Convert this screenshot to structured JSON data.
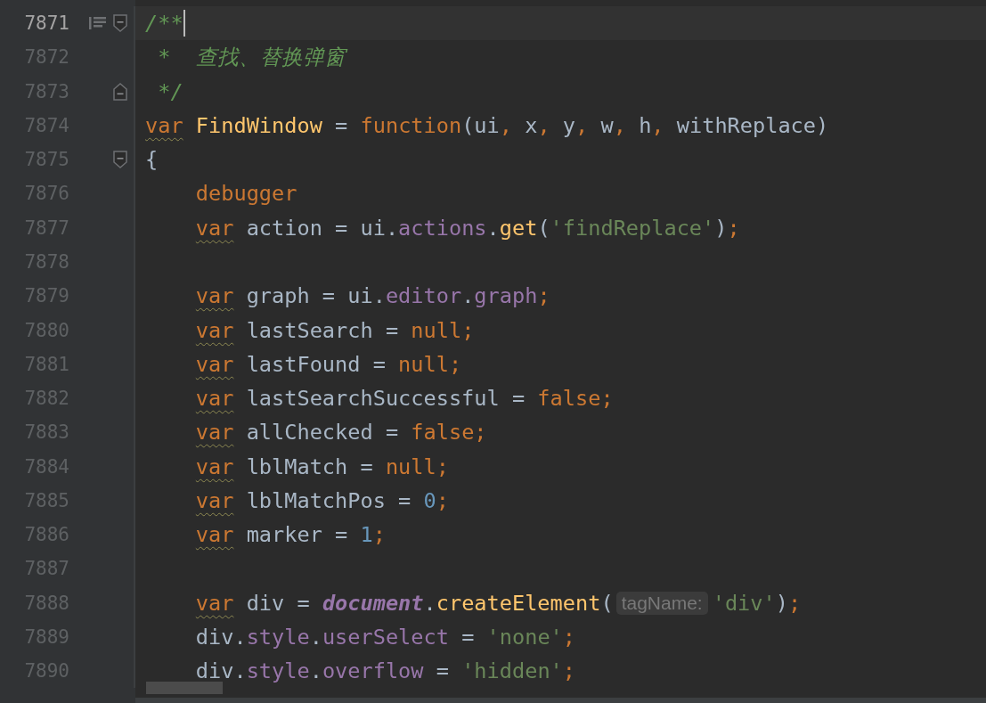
{
  "editor": {
    "lines": [
      {
        "number": "7871",
        "current": true,
        "gutter_icon": true,
        "fold_start": true,
        "fold_end": false,
        "kind": "code",
        "caret": true,
        "tokens": [
          {
            "kind": "comment",
            "text": "/**"
          }
        ]
      },
      {
        "number": "7872",
        "current": false,
        "gutter_icon": false,
        "fold_start": false,
        "fold_end": false,
        "kind": "doc-continuation",
        "caret": false,
        "tokens": [
          {
            "kind": "comment",
            "text": "*  查找、替换弹窗"
          }
        ]
      },
      {
        "number": "7873",
        "current": false,
        "gutter_icon": false,
        "fold_start": false,
        "fold_end": true,
        "kind": "doc-continuation",
        "caret": false,
        "tokens": [
          {
            "kind": "comment",
            "text": "*/"
          }
        ]
      },
      {
        "number": "7874",
        "current": false,
        "gutter_icon": false,
        "fold_start": false,
        "fold_end": false,
        "kind": "code",
        "caret": false,
        "tokens": [
          {
            "kind": "keyword",
            "text": "var",
            "warn": true
          },
          {
            "kind": "function",
            "text": " FindWindow"
          },
          {
            "kind": "plain",
            "text": " = "
          },
          {
            "kind": "keyword",
            "text": "function"
          },
          {
            "kind": "plain",
            "text": "(ui"
          },
          {
            "kind": "punct",
            "text": ", "
          },
          {
            "kind": "plain",
            "text": "x"
          },
          {
            "kind": "punct",
            "text": ", "
          },
          {
            "kind": "plain",
            "text": "y"
          },
          {
            "kind": "punct",
            "text": ", "
          },
          {
            "kind": "plain",
            "text": "w"
          },
          {
            "kind": "punct",
            "text": ", "
          },
          {
            "kind": "plain",
            "text": "h"
          },
          {
            "kind": "punct",
            "text": ", "
          },
          {
            "kind": "plain",
            "text": "withReplace)"
          }
        ]
      },
      {
        "number": "7875",
        "current": false,
        "gutter_icon": false,
        "fold_start": true,
        "fold_end": false,
        "kind": "code",
        "caret": false,
        "tokens": [
          {
            "kind": "plain",
            "text": "{"
          }
        ],
        "children": [
          {
            "number": "7876",
            "current": false,
            "gutter_icon": false,
            "fold_start": false,
            "fold_end": false,
            "kind": "code",
            "caret": false,
            "tokens": [
              {
                "kind": "keyword",
                "text": "debugger"
              }
            ]
          },
          {
            "number": "7877",
            "current": false,
            "gutter_icon": false,
            "fold_start": false,
            "fold_end": false,
            "kind": "code",
            "caret": false,
            "tokens": [
              {
                "kind": "keyword",
                "text": "var",
                "warn": true
              },
              {
                "kind": "plain",
                "text": " action = ui."
              },
              {
                "kind": "property",
                "text": "actions"
              },
              {
                "kind": "plain",
                "text": "."
              },
              {
                "kind": "function",
                "text": "get"
              },
              {
                "kind": "plain",
                "text": "("
              },
              {
                "kind": "string",
                "text": "'findReplace'"
              },
              {
                "kind": "plain",
                "text": ")"
              },
              {
                "kind": "punct",
                "text": ";"
              }
            ]
          },
          {
            "number": "7878",
            "current": false,
            "gutter_icon": false,
            "fold_start": false,
            "fold_end": false,
            "kind": "code",
            "caret": false
          },
          {
            "number": "7879",
            "current": false,
            "gutter_icon": false,
            "fold_start": false,
            "fold_end": false,
            "kind": "code",
            "caret": false,
            "tokens": [
              {
                "kind": "keyword",
                "text": "var",
                "warn": true
              },
              {
                "kind": "plain",
                "text": " graph = ui."
              },
              {
                "kind": "property",
                "text": "editor"
              },
              {
                "kind": "plain",
                "text": "."
              },
              {
                "kind": "property",
                "text": "graph"
              },
              {
                "kind": "punct",
                "text": ";"
              }
            ]
          },
          {
            "number": "7880",
            "current": false,
            "gutter_icon": false,
            "fold_start": false,
            "fold_end": false,
            "kind": "code",
            "caret": false,
            "tokens": [
              {
                "kind": "keyword",
                "text": "var",
                "warn": true
              },
              {
                "kind": "plain",
                "text": " lastSearch = "
              },
              {
                "kind": "keyword",
                "text": "null;"
              }
            ]
          },
          {
            "number": "7881",
            "current": false,
            "gutter_icon": false,
            "fold_start": false,
            "fold_end": false,
            "kind": "code",
            "caret": false,
            "tokens": [
              {
                "kind": "keyword",
                "text": "var",
                "warn": true
              },
              {
                "kind": "plain",
                "text": " lastFound = "
              },
              {
                "kind": "keyword",
                "text": "null;"
              }
            ]
          },
          {
            "number": "7882",
            "current": false,
            "gutter_icon": false,
            "fold_start": false,
            "fold_end": false,
            "kind": "code",
            "caret": false,
            "tokens": [
              {
                "kind": "keyword",
                "text": "var",
                "warn": true
              },
              {
                "kind": "plain",
                "text": " lastSearchSuccessful = "
              },
              {
                "kind": "keyword",
                "text": "false;"
              }
            ]
          },
          {
            "number": "7883",
            "current": false,
            "gutter_icon": false,
            "fold_start": false,
            "fold_end": false,
            "kind": "code",
            "caret": false,
            "tokens": [
              {
                "kind": "keyword",
                "text": "var",
                "warn": true
              },
              {
                "kind": "plain",
                "text": " allChecked = "
              },
              {
                "kind": "keyword",
                "text": "false;"
              }
            ]
          },
          {
            "number": "7884",
            "current": false,
            "gutter_icon": false,
            "fold_start": false,
            "fold_end": false,
            "kind": "code",
            "caret": false,
            "tokens": [
              {
                "kind": "keyword",
                "text": "var",
                "warn": true
              },
              {
                "kind": "plain",
                "text": " lblMatch = "
              },
              {
                "kind": "keyword",
                "text": "null;"
              }
            ]
          },
          {
            "number": "7885",
            "current": false,
            "gutter_icon": false,
            "fold_start": false,
            "fold_end": false,
            "kind": "code",
            "caret": false,
            "tokens": [
              {
                "kind": "keyword",
                "text": "var",
                "warn": true
              },
              {
                "kind": "plain",
                "text": " lblMatchPos = "
              },
              {
                "kind": "number",
                "text": "0"
              },
              {
                "kind": "punct",
                "text": ";"
              }
            ]
          },
          {
            "number": "7886",
            "current": false,
            "gutter_icon": false,
            "fold_start": false,
            "fold_end": false,
            "kind": "code",
            "caret": false,
            "tokens": [
              {
                "kind": "keyword",
                "text": "var",
                "warn": true
              },
              {
                "kind": "plain",
                "text": " marker = "
              },
              {
                "kind": "number",
                "text": "1"
              },
              {
                "kind": "punct",
                "text": ";"
              }
            ]
          },
          {
            "number": "7887",
            "current": false,
            "gutter_icon": false,
            "fold_start": false,
            "fold_end": false,
            "kind": "code",
            "caret": false
          },
          {
            "number": "7888",
            "current": false,
            "gutter_icon": false,
            "fold_start": false,
            "fold_end": false,
            "kind": "code",
            "caret": false,
            "tokens": [
              {
                "kind": "keyword",
                "text": "var",
                "warn": true
              },
              {
                "kind": "plain",
                "text": " div = "
              },
              {
                "kind": "global",
                "text": "document"
              },
              {
                "kind": "plain",
                "text": "."
              },
              {
                "kind": "function",
                "text": "createElement"
              },
              {
                "kind": "plain",
                "text": "("
              },
              {
                "kind": "hint",
                "text": "tagName:"
              },
              {
                "kind": "string",
                "text": "'div'"
              },
              {
                "kind": "plain",
                "text": ")"
              },
              {
                "kind": "punct",
                "text": ";"
              }
            ]
          },
          {
            "number": "7889",
            "current": false,
            "gutter_icon": false,
            "fold_start": false,
            "fold_end": false,
            "kind": "code",
            "caret": false,
            "tokens": [
              {
                "kind": "plain",
                "text": "div."
              },
              {
                "kind": "property",
                "text": "style"
              },
              {
                "kind": "plain",
                "text": "."
              },
              {
                "kind": "property",
                "text": "userSelect"
              },
              {
                "kind": "plain",
                "text": " = "
              },
              {
                "kind": "string",
                "text": "'none'"
              },
              {
                "kind": "punct",
                "text": ";"
              }
            ]
          },
          {
            "number": "7890",
            "current": false,
            "gutter_icon": false,
            "fold_start": false,
            "fold_end": false,
            "kind": "code",
            "caret": false,
            "tokens": [
              {
                "kind": "plain",
                "text": "div."
              },
              {
                "kind": "property",
                "text": "style"
              },
              {
                "kind": "plain",
                "text": "."
              },
              {
                "kind": "property",
                "text": "overflow"
              },
              {
                "kind": "plain",
                "text": " = "
              },
              {
                "kind": "string",
                "text": "'hidden'"
              },
              {
                "kind": "punct",
                "text": ";"
              }
            ]
          }
        ]
      }
    ]
  }
}
